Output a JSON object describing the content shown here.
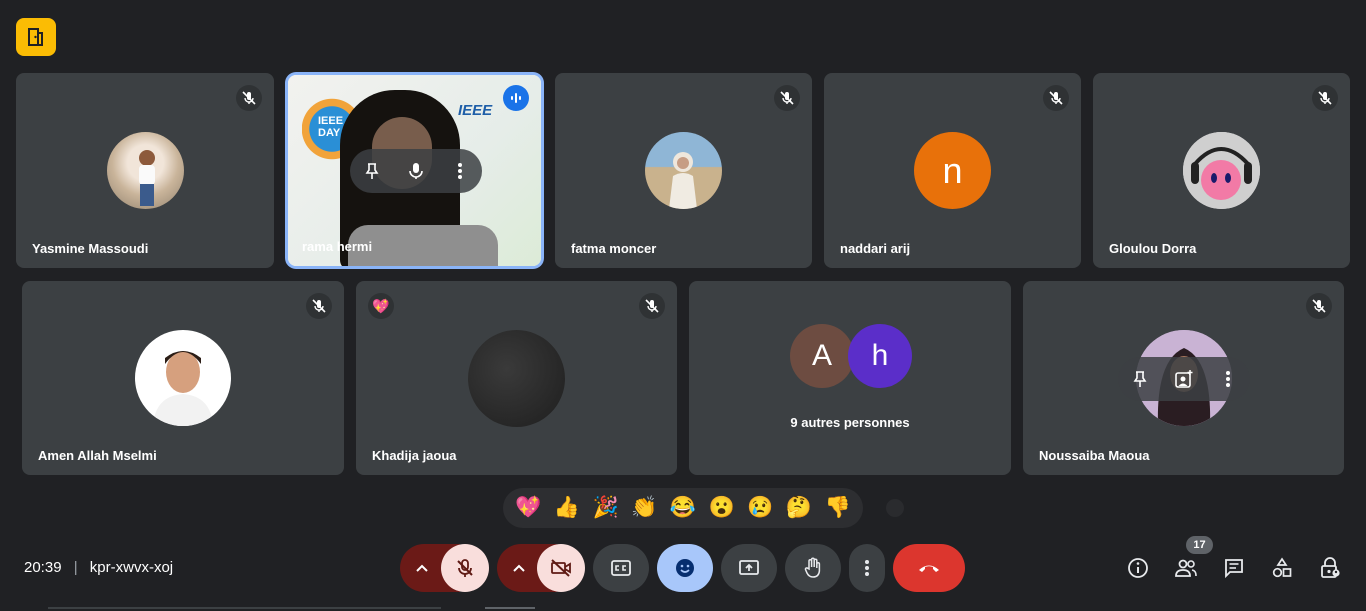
{
  "participants": [
    {
      "name": "Yasmine Massoudi",
      "type": "photo"
    },
    {
      "name": "rama hermi",
      "type": "video",
      "speaking": true
    },
    {
      "name": "fatma moncer",
      "type": "photo"
    },
    {
      "name": "naddari arij",
      "type": "letter",
      "letter": "n",
      "color": "#e8710a"
    },
    {
      "name": "Gloulou Dorra",
      "type": "photo"
    },
    {
      "name": "Amen Allah Mselmi",
      "type": "photo"
    },
    {
      "name": "Khadija jaoua",
      "type": "photo",
      "reaction": "💖"
    },
    {
      "name": "Noussaiba Maoua",
      "type": "photo"
    }
  ],
  "others": {
    "avatars": [
      "A",
      "h"
    ],
    "avatar_colors": [
      "#6d4c41",
      "#5b2ec9"
    ],
    "label": "9 autres personnes"
  },
  "video_logo": "IEEE",
  "video_sign": "IEEE DAY",
  "reactions": [
    "💖",
    "👍",
    "🎉",
    "👏",
    "😂",
    "😮",
    "😢",
    "🤔",
    "👎"
  ],
  "meeting": {
    "time": "20:39",
    "separator": "|",
    "code": "kpr-xwvx-xoj"
  },
  "people_count": "17",
  "colors": {
    "background": "#202124",
    "tile": "#3c4043",
    "accent_blue": "#8ab4f8",
    "hangup": "#ea4335",
    "muted_red": "#f9dedc",
    "activities": "#fbbc04"
  }
}
